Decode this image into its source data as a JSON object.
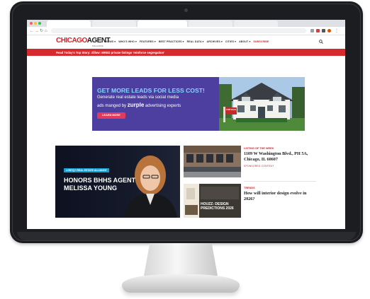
{
  "browser": {
    "window_controls": [
      "#ff5f57",
      "#febc2e",
      "#28c840"
    ],
    "nav_icons": [
      "back-icon",
      "forward-icon",
      "reload-icon",
      "home-icon"
    ]
  },
  "site": {
    "logo": {
      "part1": "CHICAGO",
      "part2": "AGENT",
      "sub": "MAGAZINE"
    },
    "nav": [
      "NEWS ▾",
      "WHO'S WHO ▾",
      "FEATURES ▾",
      "BEST PRACTICES ▾",
      "REAL DATA ▾",
      "ARCHIVES ▾",
      "CITIES ▾",
      "ABOUT ▾",
      "SUBSCRIBE"
    ],
    "brand_color": "#d0242a",
    "top_story": "Read Today's Top Story: Zillow: MRED private listings 'reinforce segregation'"
  },
  "ad": {
    "headline": "GET MORE LEADS FOR LESS COST!",
    "line1": "Generate real estate leads via social media",
    "line2_prefix": "ads manged by ",
    "brand": "zurple",
    "line2_suffix": " advertising experts",
    "cta": "LEARN MORE",
    "sign": "FOR SALE"
  },
  "featured": {
    "tag": "LGBTQ+ REAL ESTATE ALLIANCE",
    "title_line1": "HONORS BHHS AGENT",
    "title_line2": "MELISSA YOUNG"
  },
  "side_stories": [
    {
      "label": "LISTING OF THE WEEK",
      "headline": "1109 W Washington Blvd., PH 5A, Chicago, IL 60607",
      "byline": "SPONSORED CONTENT"
    },
    {
      "label": "TRENDS",
      "headline": "How will interior design evolve in 2026?",
      "thumb_line1": "HOUZZ: DESIGN",
      "thumb_line2": "PREDICTIONS 2026"
    }
  ]
}
